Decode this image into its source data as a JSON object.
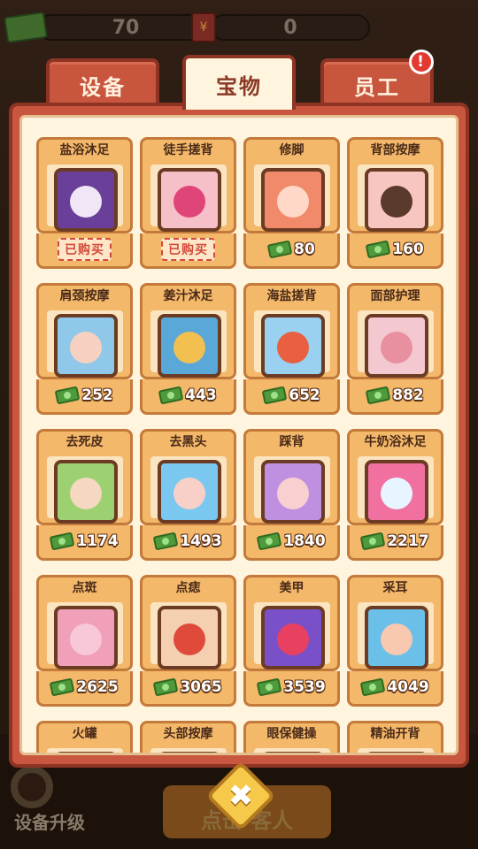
{
  "top": {
    "cash": "70",
    "envelope": "0",
    "envelope_symbol": "¥"
  },
  "tabs": [
    {
      "label": "设备",
      "active": false
    },
    {
      "label": "宝物",
      "active": true
    },
    {
      "label": "员工",
      "active": false,
      "badge": "!"
    }
  ],
  "items": [
    {
      "name": "盐浴沐足",
      "bought": true,
      "icon": "spa-salt-jar-icon",
      "colors": [
        "#6a3f9a",
        "#f0e6f6"
      ]
    },
    {
      "name": "徒手搓背",
      "bought": true,
      "icon": "scrub-brush-icon",
      "colors": [
        "#f6c0c8",
        "#e0457a"
      ]
    },
    {
      "name": "修脚",
      "bought": false,
      "price": "80",
      "icon": "foot-care-icon",
      "colors": [
        "#f08a6a",
        "#ffd8c8"
      ]
    },
    {
      "name": "背部按摩",
      "bought": false,
      "price": "160",
      "icon": "back-massage-icon",
      "colors": [
        "#f7c6c0",
        "#5a3a2a"
      ]
    },
    {
      "name": "肩颈按摩",
      "bought": false,
      "price": "252",
      "icon": "shoulder-massage-icon",
      "colors": [
        "#8fc8e8",
        "#f6d0c0"
      ]
    },
    {
      "name": "姜汁沐足",
      "bought": false,
      "price": "443",
      "icon": "ginger-foot-bath-icon",
      "colors": [
        "#5aa8d8",
        "#f2c050"
      ]
    },
    {
      "name": "海盐搓背",
      "bought": false,
      "price": "652",
      "icon": "sea-salt-scrub-icon",
      "colors": [
        "#9ad0f0",
        "#e86040"
      ]
    },
    {
      "name": "面部护理",
      "bought": false,
      "price": "882",
      "icon": "facial-care-icon",
      "colors": [
        "#f4c8d0",
        "#e890a0"
      ]
    },
    {
      "name": "去死皮",
      "bought": false,
      "price": "1174",
      "icon": "exfoliate-icon",
      "colors": [
        "#9cd070",
        "#f4d8c0"
      ]
    },
    {
      "name": "去黑头",
      "bought": false,
      "price": "1493",
      "icon": "blackhead-removal-icon",
      "colors": [
        "#7ac8f0",
        "#f8d0c8"
      ]
    },
    {
      "name": "踩背",
      "bought": false,
      "price": "1840",
      "icon": "back-walking-icon",
      "colors": [
        "#c090e0",
        "#f8d0d0"
      ]
    },
    {
      "name": "牛奶浴沐足",
      "bought": false,
      "price": "2217",
      "icon": "milk-bath-icon",
      "colors": [
        "#f070a0",
        "#e8f4ff"
      ]
    },
    {
      "name": "点斑",
      "bought": false,
      "price": "2625",
      "icon": "spot-removal-icon",
      "colors": [
        "#f0a0b8",
        "#f8c8d8"
      ]
    },
    {
      "name": "点痣",
      "bought": false,
      "price": "3065",
      "icon": "mole-removal-icon",
      "colors": [
        "#f4d0b0",
        "#e04a3a"
      ]
    },
    {
      "name": "美甲",
      "bought": false,
      "price": "3539",
      "icon": "manicure-icon",
      "colors": [
        "#7a50c8",
        "#e84060"
      ]
    },
    {
      "name": "采耳",
      "bought": false,
      "price": "4049",
      "icon": "ear-cleaning-icon",
      "colors": [
        "#6ac0e8",
        "#f8c8b0"
      ]
    },
    {
      "name": "火罐",
      "bought": false,
      "icon": "cupping-icon",
      "colors": [
        "#f0b070",
        "#c04030"
      ]
    },
    {
      "name": "头部按摩",
      "bought": false,
      "icon": "head-massage-icon",
      "colors": [
        "#f0b070",
        "#c04030"
      ]
    },
    {
      "name": "眼保健操",
      "bought": false,
      "icon": "eye-exercise-icon",
      "colors": [
        "#f0b070",
        "#c04030"
      ]
    },
    {
      "name": "精油开背",
      "bought": false,
      "icon": "essential-oil-icon",
      "colors": [
        "#f0b070",
        "#c04030"
      ]
    }
  ],
  "bought_label": "已购买",
  "bottom": {
    "upgrade_label": "设备升级",
    "action_label": "点击    客人",
    "close_symbol": "✖"
  }
}
